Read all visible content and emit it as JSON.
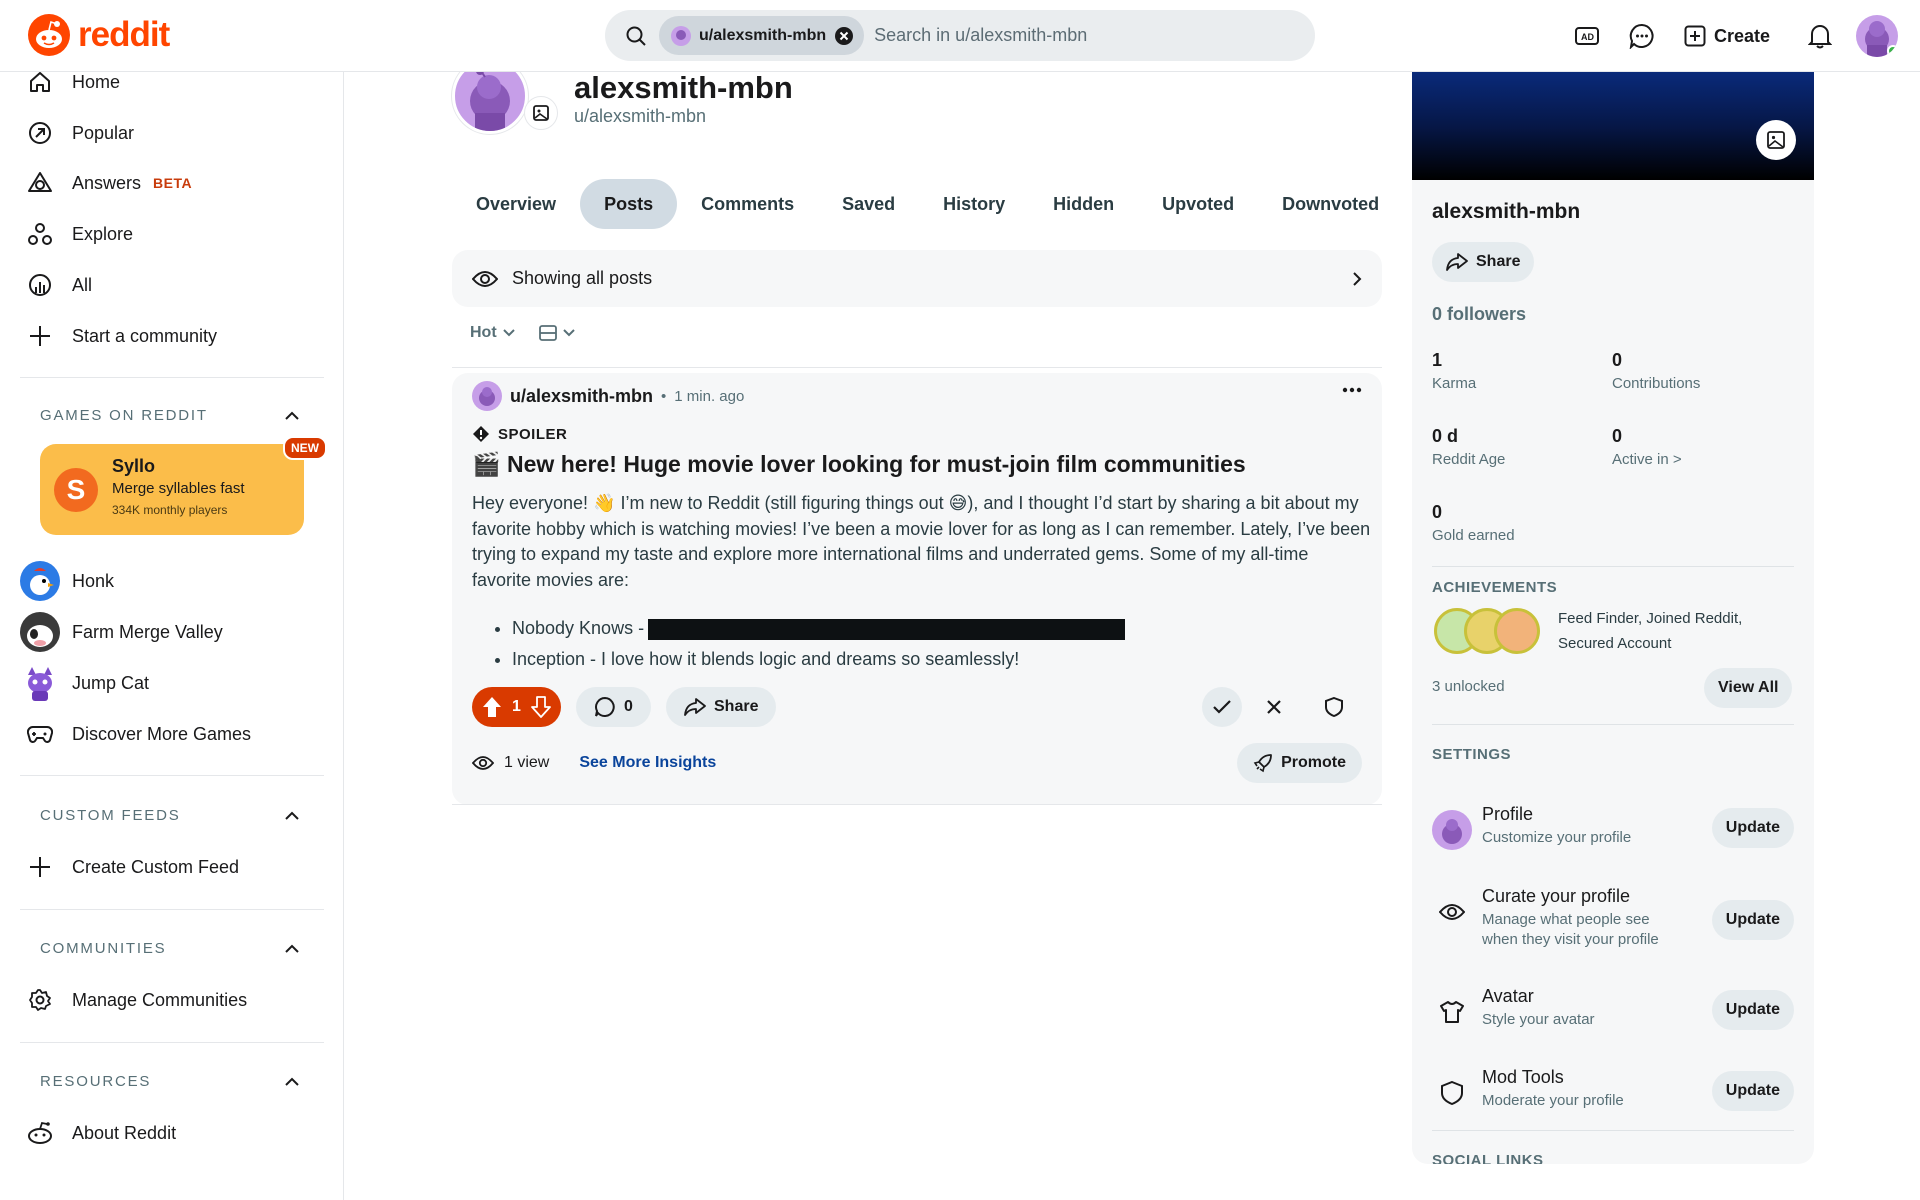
{
  "header": {
    "logo_text": "reddit",
    "search_chip": "u/alexsmith-mbn",
    "search_placeholder": "Search in u/alexsmith-mbn",
    "create_label": "Create"
  },
  "sidebar": {
    "nav": [
      {
        "label": "Home",
        "icon": "home-icon"
      },
      {
        "label": "Popular",
        "icon": "popular-icon"
      },
      {
        "label": "Answers",
        "icon": "answers-icon",
        "badge": "BETA"
      },
      {
        "label": "Explore",
        "icon": "explore-icon"
      },
      {
        "label": "All",
        "icon": "all-icon"
      },
      {
        "label": "Start a community",
        "icon": "plus-icon"
      }
    ],
    "games_header": "GAMES ON REDDIT",
    "featured_game": {
      "name": "Syllo",
      "desc": "Merge syllables fast",
      "players": "334K monthly players",
      "badge": "NEW"
    },
    "games": [
      "Honk",
      "Farm Merge Valley",
      "Jump Cat",
      "Discover More Games"
    ],
    "custom_feeds_header": "CUSTOM FEEDS",
    "create_custom_feed": "Create Custom Feed",
    "communities_header": "COMMUNITIES",
    "manage_communities": "Manage Communities",
    "resources_header": "RESOURCES",
    "about_reddit": "About Reddit"
  },
  "profile": {
    "display_name": "alexsmith-mbn",
    "username": "u/alexsmith-mbn"
  },
  "tabs": [
    "Overview",
    "Posts",
    "Comments",
    "Saved",
    "History",
    "Hidden",
    "Upvoted",
    "Downvoted"
  ],
  "active_tab": "Posts",
  "filter_text": "Showing all posts",
  "sort_label": "Hot",
  "post": {
    "author": "u/alexsmith-mbn",
    "sep": "•",
    "time": "1 min. ago",
    "spoiler": "SPOILER",
    "title": "🎬 New here! Huge movie lover looking for must-join film communities",
    "body": "Hey everyone! 👋 I’m new to Reddit (still figuring things out 😅), and I thought I’d start by sharing a bit about my favorite hobby which is watching movies! I’ve been a movie lover for as long as I can remember. Lately, I’ve been trying to expand my taste and explore more international films and underrated gems. Some of my all-time favorite movies are:",
    "bullet1": "Nobody Knows -",
    "bullet2": "Inception - I love how it blends logic and dreams so seamlessly!",
    "votes": "1",
    "comments": "0",
    "share": "Share",
    "views": "1 view",
    "insights": "See More Insights",
    "promote": "Promote"
  },
  "right": {
    "name": "alexsmith-mbn",
    "share": "Share",
    "followers": "0 followers",
    "stats": [
      {
        "value": "1",
        "label": "Karma"
      },
      {
        "value": "0",
        "label": "Contributions"
      },
      {
        "value": "0 d",
        "label": "Reddit Age"
      },
      {
        "value": "0",
        "label": "Active in >"
      },
      {
        "value": "0",
        "label": "Gold earned"
      }
    ],
    "achievements_header": "ACHIEVEMENTS",
    "achievements_text": "Feed Finder, Joined Reddit, Secured Account",
    "unlocked": "3 unlocked",
    "view_all": "View All",
    "settings_header": "SETTINGS",
    "settings": [
      {
        "title": "Profile",
        "desc": "Customize your profile",
        "button": "Update"
      },
      {
        "title": "Curate your profile",
        "desc": "Manage what people see when they visit your profile",
        "button": "Update"
      },
      {
        "title": "Avatar",
        "desc": "Style your avatar",
        "button": "Update"
      },
      {
        "title": "Mod Tools",
        "desc": "Moderate your profile",
        "button": "Update"
      }
    ],
    "social_header": "SOCIAL LINKS"
  },
  "colors": {
    "brand": "#ff4500",
    "upvote_bg": "#d93a00",
    "link": "#0a449b",
    "game_card": "#fbbd4a"
  }
}
